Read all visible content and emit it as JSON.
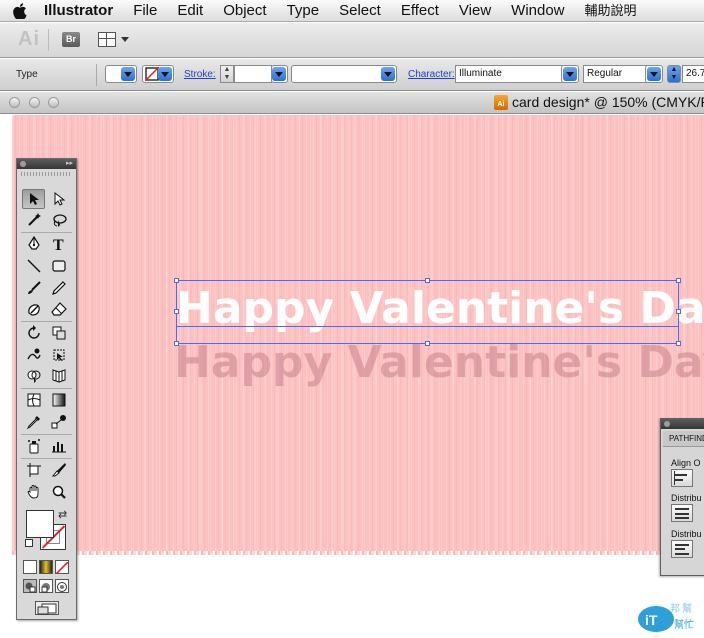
{
  "menubar": {
    "app_name": "Illustrator",
    "items": [
      "File",
      "Edit",
      "Object",
      "Type",
      "Select",
      "Effect",
      "View",
      "Window",
      "輔助說明"
    ]
  },
  "appbar": {
    "logo": "Ai",
    "bridge_label": "Br"
  },
  "controlbar": {
    "type_label": "Type",
    "stroke_label": "Stroke:",
    "character_label": "Character:",
    "font_family": "Illuminate",
    "font_style": "Regular",
    "font_size": "26.7"
  },
  "document": {
    "icon_label": "Ai",
    "title": "card design* @ 150% (CMYK/P"
  },
  "artwork": {
    "headline": "Happy Valentine's Day",
    "shadow_headline": "Happy Valentine's Day",
    "background_color": "#fcc2c2",
    "selection_color": "#4e68ff"
  },
  "pathfinder": {
    "tab_label": "PATHFINDER",
    "align_label": "Align O",
    "distribute_label_1": "Distribu",
    "distribute_label_2": "Distribu"
  },
  "tools_panel": {
    "tools": [
      "selection-tool",
      "direct-selection-tool",
      "magic-wand-tool",
      "lasso-tool",
      "pen-tool",
      "type-tool",
      "line-segment-tool",
      "rectangle-tool",
      "paintbrush-tool",
      "pencil-tool",
      "blob-brush-tool",
      "eraser-tool",
      "rotate-tool",
      "scale-tool",
      "warp-tool",
      "free-transform-tool",
      "shape-builder-tool",
      "perspective-grid-tool",
      "mesh-tool",
      "gradient-tool",
      "eyedropper-tool",
      "blend-tool",
      "symbol-sprayer-tool",
      "column-graph-tool",
      "artboard-tool",
      "slice-tool",
      "hand-tool",
      "zoom-tool"
    ]
  },
  "watermark": {
    "text": "IT幫幫忙"
  }
}
